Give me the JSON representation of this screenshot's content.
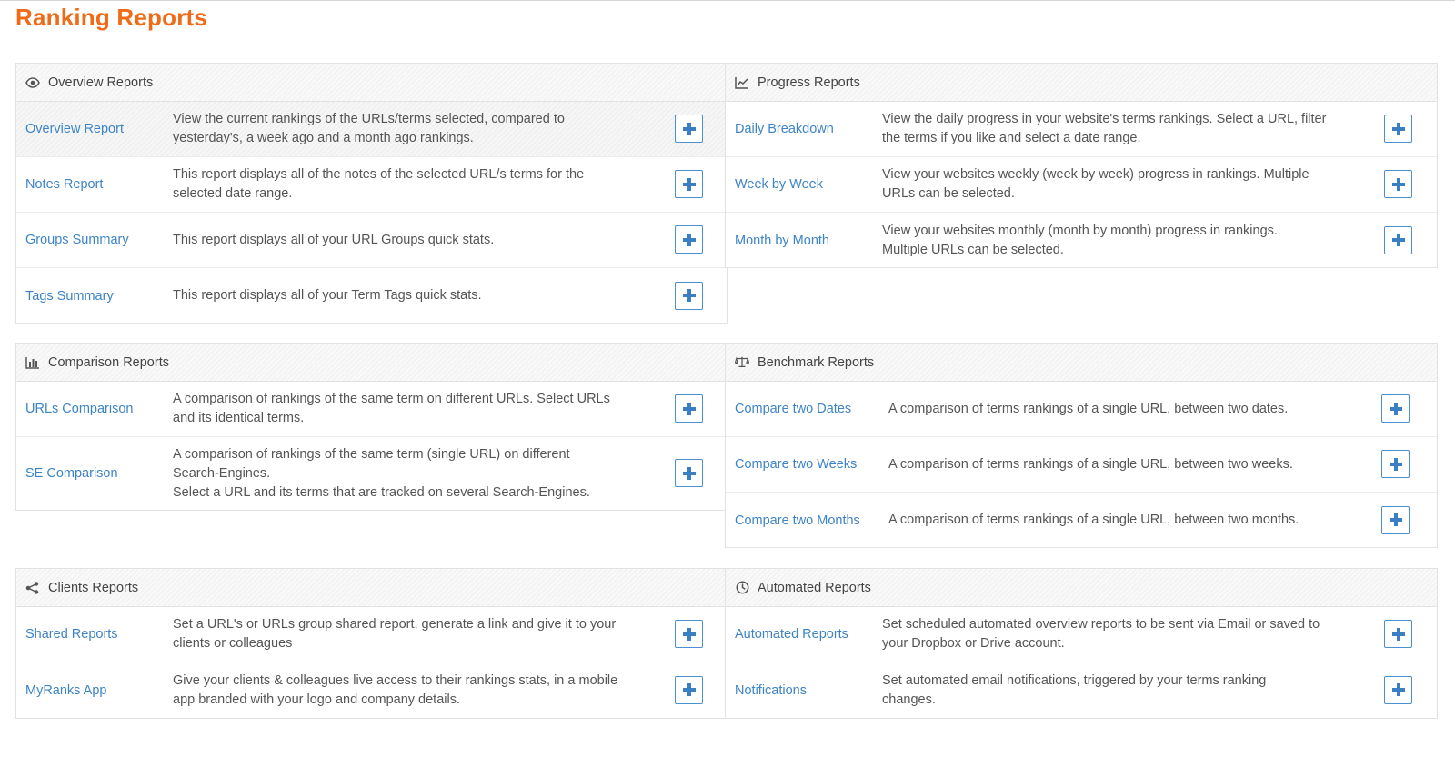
{
  "page": {
    "title": "Ranking Reports",
    "accent": "#ef6b17",
    "link_color": "#3d84c6"
  },
  "overview": {
    "title": "Overview Reports",
    "icon": "eye-icon",
    "rows": [
      {
        "name": "Overview Report",
        "desc": [
          "View the current rankings of the URLs/terms selected, compared to",
          "yesterday's, a week ago and a month ago rankings."
        ]
      },
      {
        "name": "Notes Report",
        "desc": [
          "This report displays all of the notes of the selected URL/s terms for the",
          "selected date range."
        ]
      },
      {
        "name": "Groups Summary",
        "desc": [
          "This report displays all of your URL Groups quick stats."
        ]
      },
      {
        "name": "Tags Summary",
        "desc": [
          "This report displays all of your Term Tags quick stats."
        ]
      }
    ]
  },
  "progress": {
    "title": "Progress Reports",
    "icon": "line-chart-icon",
    "rows": [
      {
        "name": "Daily Breakdown",
        "desc": [
          "View the daily progress in your website's terms rankings. Select a URL, filter",
          "the terms if you like and select a date range."
        ]
      },
      {
        "name": "Week by Week",
        "desc": [
          "View your websites weekly (week by week) progress in rankings. Multiple",
          "URLs can be selected."
        ]
      },
      {
        "name": "Month by Month",
        "desc": [
          "View your websites monthly (month by month) progress in rankings.",
          "Multiple URLs can be selected."
        ]
      }
    ]
  },
  "comparison": {
    "title": "Comparison Reports",
    "icon": "bar-chart-icon",
    "rows": [
      {
        "name": "URLs Comparison",
        "desc": [
          "A comparison of rankings of the same term on different URLs. Select URLs",
          "and its identical terms."
        ]
      },
      {
        "name": "SE Comparison",
        "desc": [
          "A comparison of rankings of the same term (single URL) on different",
          "Search-Engines.",
          "Select a URL and its terms that are tracked on several Search-Engines."
        ]
      }
    ]
  },
  "benchmark": {
    "title": "Benchmark Reports",
    "icon": "scale-icon",
    "rows": [
      {
        "name": "Compare two Dates",
        "desc": [
          "A comparison of terms rankings of a single URL, between two dates."
        ]
      },
      {
        "name": "Compare two Weeks",
        "desc": [
          "A comparison of terms rankings of a single URL, between two weeks."
        ]
      },
      {
        "name": "Compare two Months",
        "desc": [
          "A comparison of terms rankings of a single URL, between two months."
        ]
      }
    ]
  },
  "clients": {
    "title": "Clients Reports",
    "icon": "share-icon",
    "rows": [
      {
        "name": "Shared Reports",
        "desc": [
          "Set a URL's or URLs group shared report, generate a link and give it to your",
          "clients or colleagues"
        ]
      },
      {
        "name": "MyRanks App",
        "desc": [
          "Give your clients & colleagues live access to their rankings stats, in a mobile",
          "app branded with your logo and company details."
        ]
      }
    ]
  },
  "automated": {
    "title": "Automated Reports",
    "icon": "clock-icon",
    "rows": [
      {
        "name": "Automated Reports",
        "desc": [
          "Set scheduled automated overview reports to be sent via Email or saved to",
          "your Dropbox or Drive account."
        ]
      },
      {
        "name": "Notifications",
        "desc": [
          "Set automated email notifications, triggered by your terms ranking",
          "changes."
        ]
      }
    ]
  }
}
